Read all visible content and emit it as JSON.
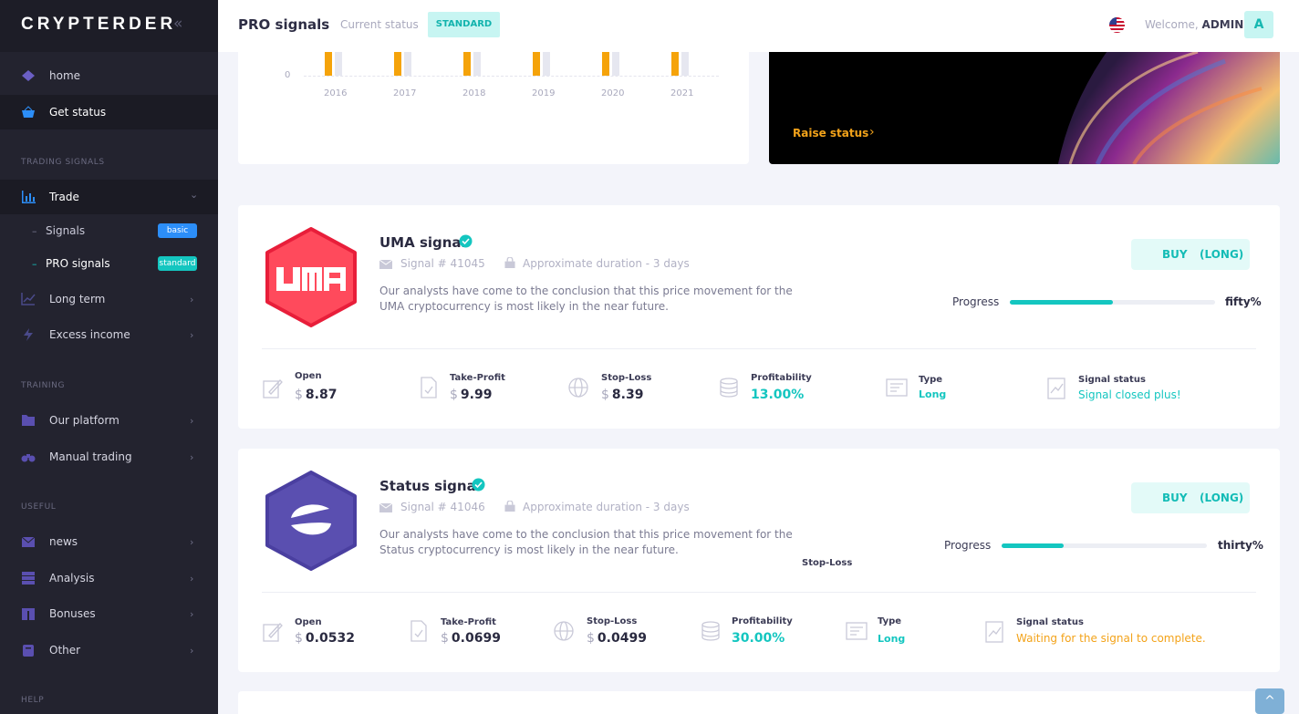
{
  "sidebar": {
    "brand": "CRYPTERDER",
    "collapse_icon": "«",
    "items": [
      {
        "label": "home",
        "icon": "home-icon"
      },
      {
        "label": "Get status",
        "icon": "basket-icon"
      }
    ],
    "sections": {
      "trading": "TRADING SIGNALS",
      "training": "TRAINING",
      "useful": "USEFUL",
      "help": "HELP"
    },
    "trade": {
      "label": "Trade",
      "chevron": "⌄"
    },
    "sub": [
      {
        "label": "Signals",
        "badge": "basic"
      },
      {
        "label": "PRO signals",
        "badge": "standard"
      }
    ],
    "long_term": "Long term",
    "excess_income": "Excess income",
    "our_platform": "Our platform",
    "manual_trading": "Manual trading",
    "news": "news",
    "analysis": "Analysis",
    "bonuses": "Bonuses",
    "other": "Other",
    "chevron": "›",
    "dash": "–"
  },
  "header": {
    "title": "PRO signals",
    "current_status_label": "Current status",
    "status_badge": "STANDARD",
    "welcome": "Welcome,",
    "user": "ADMIN",
    "avatar_letter": "A"
  },
  "chart_data": {
    "type": "bar",
    "categories": [
      "2016",
      "2017",
      "2018",
      "2019",
      "2020",
      "2021"
    ],
    "y_tick_visible": "0",
    "series": [
      {
        "color": "#f5a30a"
      },
      {
        "color": "#e6e7f0"
      }
    ]
  },
  "promo": {
    "raise_label": "Raise status",
    "arrow": "›"
  },
  "signals": [
    {
      "title": "UMA signal",
      "signal_no": "Signal # 41045",
      "duration": "Approximate duration - 3 days",
      "description": "Our analysts have come to the conclusion that this price movement for the UMA cryptocurrency is most likely in the near future.",
      "buy": "BUY",
      "long": "(LONG)",
      "progress_label": "Progress",
      "progress_value": "fifty%",
      "progress_fraction": 0.5,
      "open_label": "Open",
      "open_cur": "$",
      "open": "8.87",
      "tp_label": "Take-Profit",
      "tp_cur": "$",
      "tp": "9.99",
      "sl_label": "Stop-Loss",
      "sl_cur": "$",
      "sl": "8.39",
      "prof_label": "Profitability",
      "prof": "13.00%",
      "type_label": "Type",
      "type": "Long",
      "status_label": "Signal status",
      "status": "Signal closed plus!",
      "status_color": "#14c6c0"
    },
    {
      "title": "Status signal",
      "signal_no": "Signal # 41046",
      "duration": "Approximate duration - 3 days",
      "description": "Our analysts have come to the conclusion that this price movement for the Status cryptocurrency is most likely in the near future.",
      "buy": "BUY",
      "long": "(LONG)",
      "progress_label": "Progress",
      "progress_value": "thirty%",
      "progress_fraction": 0.3,
      "floating_label": "Stop-Loss",
      "open_label": "Open",
      "open_cur": "$",
      "open": "0.0532",
      "tp_label": "Take-Profit",
      "tp_cur": "$",
      "tp": "0.0699",
      "sl_label": "Stop-Loss",
      "sl_cur": "$",
      "sl": "0.0499",
      "prof_label": "Profitability",
      "prof": "30.00%",
      "type_label": "Type",
      "type": "Long",
      "status_label": "Signal status",
      "status": "Waiting for the signal to complete.",
      "status_color": "#f3a31a"
    }
  ],
  "scroll_top_icon": "^"
}
